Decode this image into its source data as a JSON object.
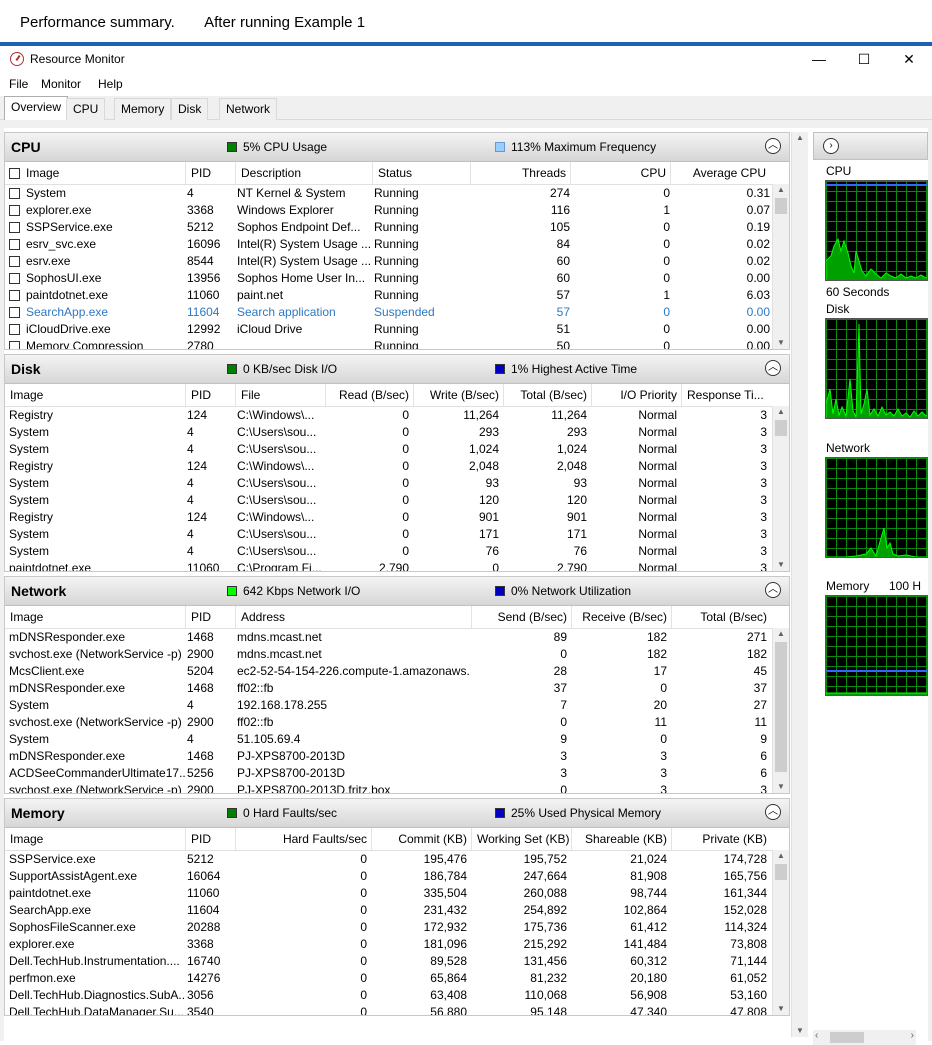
{
  "caption": {
    "text1": "Performance summary.",
    "text2": "After running Example 1"
  },
  "window": {
    "title": "Resource Monitor",
    "minimize": "—",
    "maximize": "☐",
    "close": "✕"
  },
  "menu": [
    "File",
    "Monitor",
    "Help"
  ],
  "tabs": [
    "Overview",
    "CPU",
    "Memory",
    "Disk",
    "Network"
  ],
  "colors": {
    "accent": "#1f5fb4",
    "green": "#008000",
    "blue": "#0000c0",
    "lightblue": "#99ccff",
    "brightgreen": "#00ff00",
    "link": "#2f78c4"
  },
  "cpu": {
    "title": "CPU",
    "stat1": "5% CPU Usage",
    "stat2": "113% Maximum Frequency",
    "columns": [
      "Image",
      "PID",
      "Description",
      "Status",
      "Threads",
      "CPU",
      "Average CPU"
    ],
    "rows": [
      [
        "System",
        "4",
        "NT Kernel & System",
        "Running",
        "274",
        "0",
        "0.31"
      ],
      [
        "explorer.exe",
        "3368",
        "Windows Explorer",
        "Running",
        "116",
        "1",
        "0.07"
      ],
      [
        "SSPService.exe",
        "5212",
        "Sophos Endpoint Def...",
        "Running",
        "105",
        "0",
        "0.19"
      ],
      [
        "esrv_svc.exe",
        "16096",
        "Intel(R) System Usage ...",
        "Running",
        "84",
        "0",
        "0.02"
      ],
      [
        "esrv.exe",
        "8544",
        "Intel(R) System Usage ...",
        "Running",
        "60",
        "0",
        "0.02"
      ],
      [
        "SophosUI.exe",
        "13956",
        "Sophos Home User In...",
        "Running",
        "60",
        "0",
        "0.00"
      ],
      [
        "paintdotnet.exe",
        "11060",
        "paint.net",
        "Running",
        "57",
        "1",
        "6.03"
      ],
      [
        "SearchApp.exe",
        "11604",
        "Search application",
        "Suspended",
        "57",
        "0",
        "0.00"
      ],
      [
        "iCloudDrive.exe",
        "12992",
        "iCloud Drive",
        "Running",
        "51",
        "0",
        "0.00"
      ],
      [
        "Memory Compression",
        "2780",
        "",
        "Running",
        "50",
        "0",
        "0.00"
      ]
    ]
  },
  "disk": {
    "title": "Disk",
    "stat1": "0 KB/sec Disk I/O",
    "stat2": "1% Highest Active Time",
    "columns": [
      "Image",
      "PID",
      "File",
      "Read (B/sec)",
      "Write (B/sec)",
      "Total (B/sec)",
      "I/O Priority",
      "Response Ti..."
    ],
    "rows": [
      [
        "Registry",
        "124",
        "C:\\Windows\\...",
        "0",
        "11,264",
        "11,264",
        "Normal",
        "3"
      ],
      [
        "System",
        "4",
        "C:\\Users\\sou...",
        "0",
        "293",
        "293",
        "Normal",
        "3"
      ],
      [
        "System",
        "4",
        "C:\\Users\\sou...",
        "0",
        "1,024",
        "1,024",
        "Normal",
        "3"
      ],
      [
        "Registry",
        "124",
        "C:\\Windows\\...",
        "0",
        "2,048",
        "2,048",
        "Normal",
        "3"
      ],
      [
        "System",
        "4",
        "C:\\Users\\sou...",
        "0",
        "93",
        "93",
        "Normal",
        "3"
      ],
      [
        "System",
        "4",
        "C:\\Users\\sou...",
        "0",
        "120",
        "120",
        "Normal",
        "3"
      ],
      [
        "Registry",
        "124",
        "C:\\Windows\\...",
        "0",
        "901",
        "901",
        "Normal",
        "3"
      ],
      [
        "System",
        "4",
        "C:\\Users\\sou...",
        "0",
        "171",
        "171",
        "Normal",
        "3"
      ],
      [
        "System",
        "4",
        "C:\\Users\\sou...",
        "0",
        "76",
        "76",
        "Normal",
        "3"
      ],
      [
        "paintdotnet.exe",
        "11060",
        "C:\\Program Fi...",
        "2,790",
        "0",
        "2,790",
        "Normal",
        "3"
      ]
    ]
  },
  "network": {
    "title": "Network",
    "stat1": "642 Kbps Network I/O",
    "stat2": "0% Network Utilization",
    "columns": [
      "Image",
      "PID",
      "Address",
      "Send (B/sec)",
      "Receive (B/sec)",
      "Total (B/sec)"
    ],
    "rows": [
      [
        "mDNSResponder.exe",
        "1468",
        "mdns.mcast.net",
        "89",
        "182",
        "271"
      ],
      [
        "svchost.exe (NetworkService -p)",
        "2900",
        "mdns.mcast.net",
        "0",
        "182",
        "182"
      ],
      [
        "McsClient.exe",
        "5204",
        "ec2-52-54-154-226.compute-1.amazonaws...",
        "28",
        "17",
        "45"
      ],
      [
        "mDNSResponder.exe",
        "1468",
        "ff02::fb",
        "37",
        "0",
        "37"
      ],
      [
        "System",
        "4",
        "192.168.178.255",
        "7",
        "20",
        "27"
      ],
      [
        "svchost.exe (NetworkService -p)",
        "2900",
        "ff02::fb",
        "0",
        "11",
        "11"
      ],
      [
        "System",
        "4",
        "51.105.69.4",
        "9",
        "0",
        "9"
      ],
      [
        "mDNSResponder.exe",
        "1468",
        "PJ-XPS8700-2013D",
        "3",
        "3",
        "6"
      ],
      [
        "ACDSeeCommanderUltimate17....",
        "5256",
        "PJ-XPS8700-2013D",
        "3",
        "3",
        "6"
      ],
      [
        "svchost.exe (NetworkService -p)",
        "2900",
        "PJ-XPS8700-2013D.fritz.box",
        "0",
        "3",
        "3"
      ]
    ]
  },
  "memory": {
    "title": "Memory",
    "stat1": "0 Hard Faults/sec",
    "stat2": "25% Used Physical Memory",
    "columns": [
      "Image",
      "PID",
      "Hard Faults/sec",
      "Commit (KB)",
      "Working Set (KB)",
      "Shareable (KB)",
      "Private (KB)"
    ],
    "rows": [
      [
        "SSPService.exe",
        "5212",
        "0",
        "195,476",
        "195,752",
        "21,024",
        "174,728"
      ],
      [
        "SupportAssistAgent.exe",
        "16064",
        "0",
        "186,784",
        "247,664",
        "81,908",
        "165,756"
      ],
      [
        "paintdotnet.exe",
        "11060",
        "0",
        "335,504",
        "260,088",
        "98,744",
        "161,344"
      ],
      [
        "SearchApp.exe",
        "11604",
        "0",
        "231,432",
        "254,892",
        "102,864",
        "152,028"
      ],
      [
        "SophosFileScanner.exe",
        "20288",
        "0",
        "172,932",
        "175,736",
        "61,412",
        "114,324"
      ],
      [
        "explorer.exe",
        "3368",
        "0",
        "181,096",
        "215,292",
        "141,484",
        "73,808"
      ],
      [
        "Dell.TechHub.Instrumentation....",
        "16740",
        "0",
        "89,528",
        "131,456",
        "60,312",
        "71,144"
      ],
      [
        "perfmon.exe",
        "14276",
        "0",
        "65,864",
        "81,232",
        "20,180",
        "61,052"
      ],
      [
        "Dell.TechHub.Diagnostics.SubA...",
        "3056",
        "0",
        "63,408",
        "110,068",
        "56,908",
        "53,160"
      ],
      [
        "Dell.TechHub.DataManager.Su...",
        "3540",
        "0",
        "56,880",
        "95,148",
        "47,340",
        "47,808"
      ]
    ]
  },
  "right": {
    "cpu_label": "CPU",
    "cpu_time": "60 Seconds",
    "disk_label": "Disk",
    "network_label": "Network",
    "memory_label": "Memory",
    "memory_max": "100 H"
  }
}
